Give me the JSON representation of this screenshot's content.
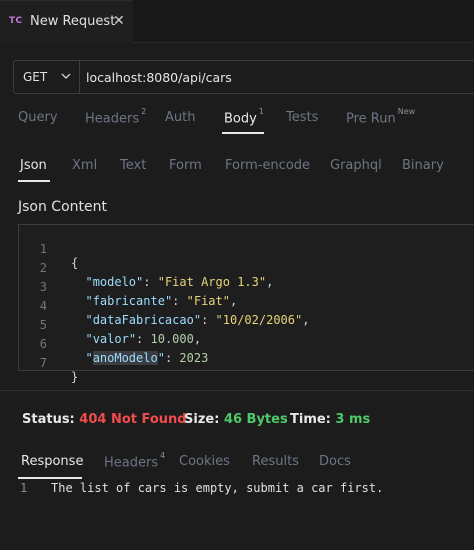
{
  "tab": {
    "logo": "TC",
    "title": "New Request",
    "close_icon": "close-icon"
  },
  "request": {
    "method": "GET",
    "url": "localhost:8080/api/cars"
  },
  "request_tabs": [
    {
      "label": "Query",
      "badge": ""
    },
    {
      "label": "Headers",
      "badge": "2"
    },
    {
      "label": "Auth",
      "badge": ""
    },
    {
      "label": "Body",
      "badge": "1"
    },
    {
      "label": "Tests",
      "badge": ""
    },
    {
      "label": "Pre Run",
      "badge": "New"
    }
  ],
  "active_request_tab": "Body",
  "body_tabs": [
    "Json",
    "Xml",
    "Text",
    "Form",
    "Form-encode",
    "Graphql",
    "Binary"
  ],
  "active_body_tab": "Json",
  "content_title": "Json Content",
  "code": {
    "line_numbers": [
      "1",
      "2",
      "3",
      "4",
      "5",
      "6",
      "7"
    ],
    "open_brace": "{",
    "close_brace": "}",
    "fields": [
      {
        "key": "modelo",
        "value": "\"Fiat Argo 1.3\"",
        "type": "string"
      },
      {
        "key": "fabricante",
        "value": "\"Fiat\"",
        "type": "string"
      },
      {
        "key": "dataFabricacao",
        "value": "\"10/02/2006\"",
        "type": "string"
      },
      {
        "key": "valor",
        "value": "10.000",
        "type": "number"
      },
      {
        "key": "anoModelo",
        "value": "2023",
        "type": "number"
      }
    ]
  },
  "status": {
    "status_label": "Status:",
    "status_value": "404 Not Found",
    "size_label": "Size:",
    "size_value": "46 Bytes",
    "time_label": "Time:",
    "time_value": "3 ms"
  },
  "response_tabs": [
    {
      "label": "Response",
      "badge": ""
    },
    {
      "label": "Headers",
      "badge": "4"
    },
    {
      "label": "Cookies",
      "badge": ""
    },
    {
      "label": "Results",
      "badge": ""
    },
    {
      "label": "Docs",
      "badge": ""
    }
  ],
  "active_response_tab": "Response",
  "response": {
    "line_number": "1",
    "text": "The list of cars is empty, submit a car first."
  },
  "colors": {
    "background": "#1c1c1c",
    "accent_logo": "#c678dd",
    "error": "#f14c4c",
    "success": "#4ec969",
    "json_key": "#9cdcfe",
    "json_string": "#ce9178",
    "json_number": "#b5cea8"
  }
}
